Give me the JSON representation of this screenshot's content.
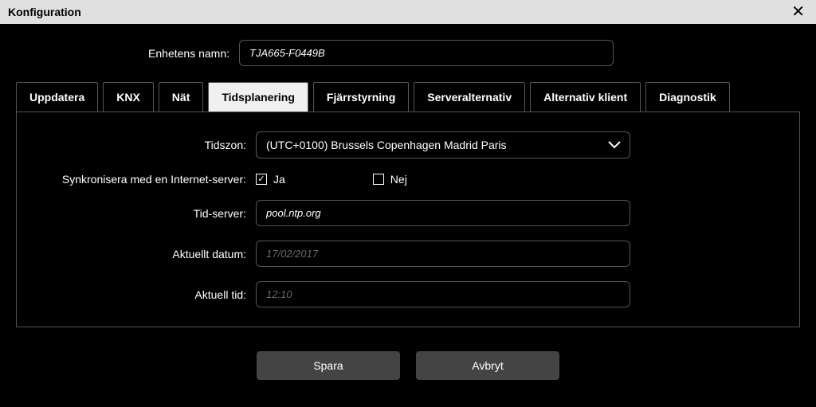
{
  "title": "Konfiguration",
  "device": {
    "label": "Enhetens namn:",
    "value": "TJA665-F0449B"
  },
  "tabs": [
    {
      "label": "Uppdatera",
      "active": false
    },
    {
      "label": "KNX",
      "active": false
    },
    {
      "label": "Nät",
      "active": false
    },
    {
      "label": "Tidsplanering",
      "active": true
    },
    {
      "label": "Fjärrstyrning",
      "active": false
    },
    {
      "label": "Serveralternativ",
      "active": false
    },
    {
      "label": "Alternativ klient",
      "active": false
    },
    {
      "label": "Diagnostik",
      "active": false
    }
  ],
  "panel": {
    "timezone": {
      "label": "Tidszon:",
      "selected": "(UTC+0100) Brussels Copenhagen Madrid Paris"
    },
    "sync": {
      "label": "Synkronisera med en Internet-server:",
      "yes": "Ja",
      "no": "Nej",
      "value": true
    },
    "timeserver": {
      "label": "Tid-server:",
      "value": "pool.ntp.org"
    },
    "date": {
      "label": "Aktuellt datum:",
      "value": "17/02/2017"
    },
    "time": {
      "label": "Aktuell tid:",
      "value": "12:10"
    }
  },
  "actions": {
    "save": "Spara",
    "cancel": "Avbryt"
  }
}
